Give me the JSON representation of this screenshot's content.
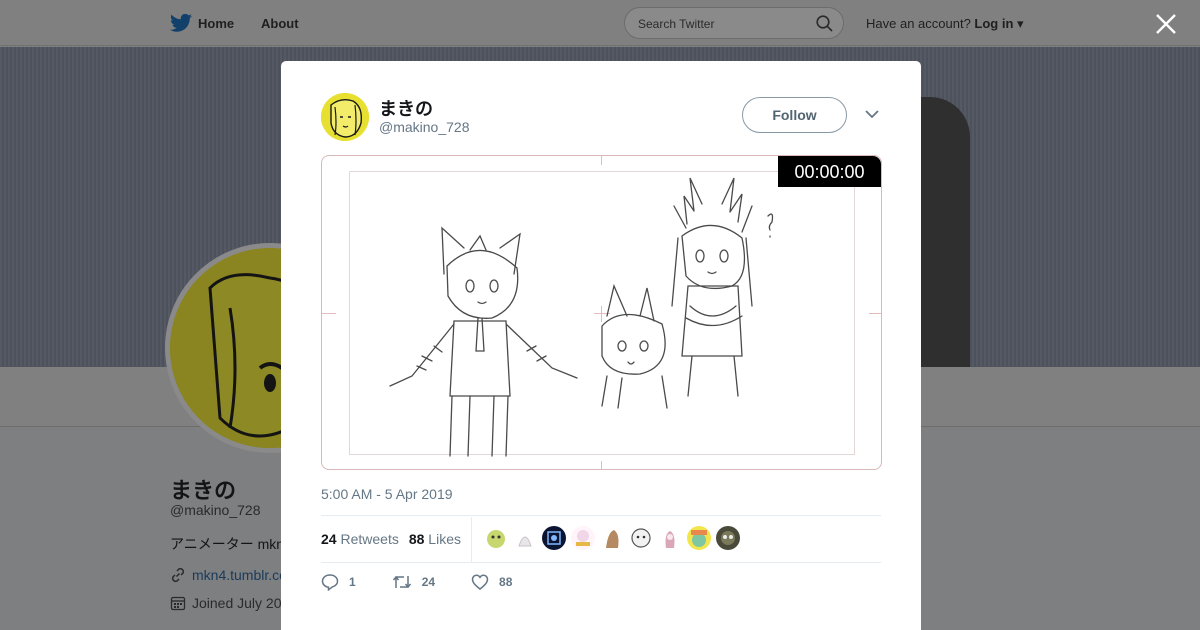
{
  "topnav": {
    "home_label": "Home",
    "about_label": "About",
    "search_placeholder": "Search Twitter",
    "account_prompt": "Have an account?",
    "login_label": "Log in"
  },
  "profile": {
    "name": "まきの",
    "handle": "@makino_728",
    "bio": "アニメーター mkn",
    "link": "mkn4.tumblr.co",
    "joined": "Joined July 20"
  },
  "tweet": {
    "author_name": "まきの",
    "author_handle": "@makino_728",
    "follow_label": "Follow",
    "video_timer": "00:00:00",
    "timestamp": "5:00 AM - 5 Apr 2019",
    "retweets_count": "24",
    "retweets_label": "Retweets",
    "likes_count": "88",
    "likes_label": "Likes",
    "actions": {
      "reply_count": "1",
      "retweet_count": "24",
      "like_count": "88"
    },
    "likers": [
      {
        "color": "#c7d66f"
      },
      {
        "color": "#e9e6ea"
      },
      {
        "color": "#1b2a55"
      },
      {
        "color": "#f1d6e8"
      },
      {
        "color": "#b58a62"
      },
      {
        "color": "#bdbdbd"
      },
      {
        "color": "#d9a7b9"
      },
      {
        "color": "#7fc6a2"
      },
      {
        "color": "#4a4a3a"
      }
    ]
  },
  "colors": {
    "twitter_blue": "#1da1f2",
    "avatar_yellow": "#e8e030"
  }
}
